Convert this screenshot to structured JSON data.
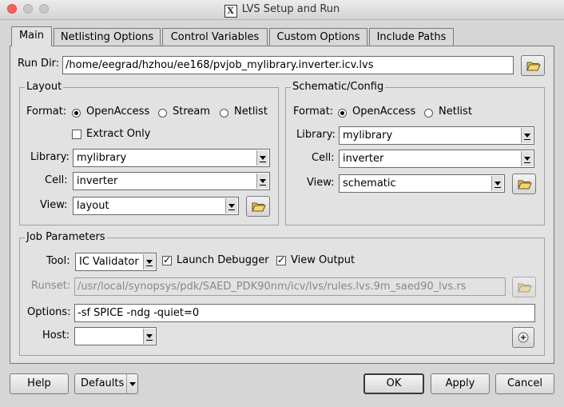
{
  "window": {
    "title": "LVS Setup and Run",
    "app_icon": "x11-icon"
  },
  "tabs": [
    {
      "label": "Main",
      "active": true
    },
    {
      "label": "Netlisting Options"
    },
    {
      "label": "Control Variables"
    },
    {
      "label": "Custom Options"
    },
    {
      "label": "Include Paths"
    }
  ],
  "run_dir": {
    "label": "Run Dir:",
    "value": "/home/eegrad/hzhou/ee168/pvjob_mylibrary.inverter.icv.lvs"
  },
  "layout": {
    "title": "Layout",
    "format_label": "Format:",
    "formats": [
      "OpenAccess",
      "Stream",
      "Netlist"
    ],
    "selected_format": "OpenAccess",
    "extract_only": {
      "label": "Extract Only",
      "checked": false
    },
    "library_label": "Library:",
    "library": "mylibrary",
    "cell_label": "Cell:",
    "cell": "inverter",
    "view_label": "View:",
    "view": "layout"
  },
  "schematic": {
    "title": "Schematic/Config",
    "format_label": "Format:",
    "formats": [
      "OpenAccess",
      "Netlist"
    ],
    "selected_format": "OpenAccess",
    "library_label": "Library:",
    "library": "mylibrary",
    "cell_label": "Cell:",
    "cell": "inverter",
    "view_label": "View:",
    "view": "schematic"
  },
  "job": {
    "title": "Job Parameters",
    "tool_label": "Tool:",
    "tool": "IC Validator",
    "launch_debugger": {
      "label": "Launch Debugger",
      "checked": true
    },
    "view_output": {
      "label": "View Output",
      "checked": true
    },
    "runset_label": "Runset:",
    "runset": "/usr/local/synopsys/pdk/SAED_PDK90nm/icv/lvs/rules.lvs.9m_saed90_lvs.rs",
    "options_label": "Options:",
    "options": "-sf SPICE -ndg -quiet=0",
    "host_label": "Host:",
    "host": ""
  },
  "footer": {
    "help": "Help",
    "defaults": "Defaults",
    "ok": "OK",
    "apply": "Apply",
    "cancel": "Cancel"
  }
}
